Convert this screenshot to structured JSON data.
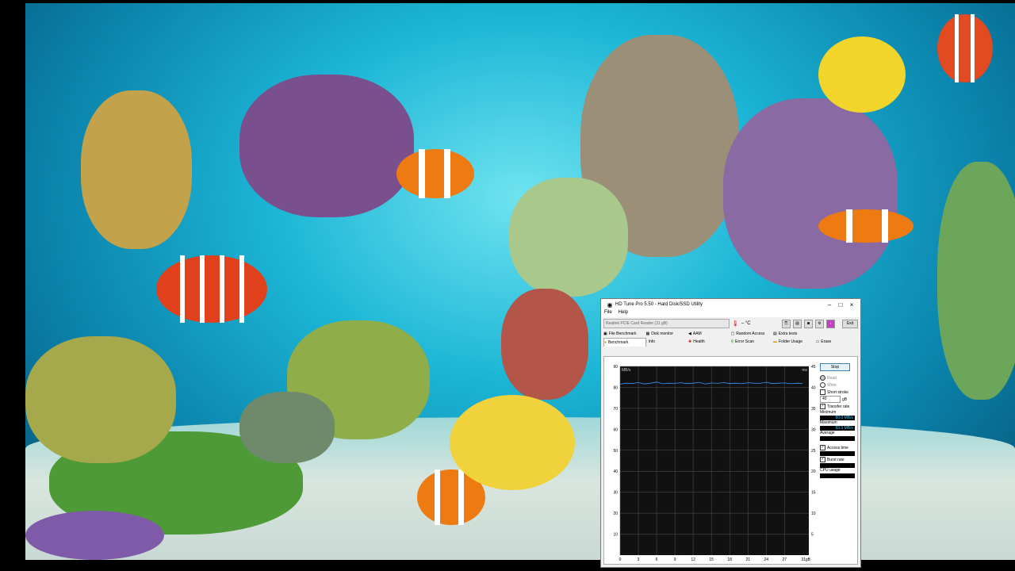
{
  "window": {
    "title": "HD Tune Pro 5.50 - Hard Disk/SSD Utility",
    "minimize": "–",
    "maximize": "□",
    "close": "×"
  },
  "menu": [
    "File",
    "Help"
  ],
  "toolbar": {
    "drive": "Realtek PCIE Card Reader (31 gB)",
    "temperature": "– °C",
    "exit": "Exit"
  },
  "tabs": {
    "row1": [
      "File Benchmark",
      "Disk monitor",
      "AAM",
      "Random Access",
      "Extra tests"
    ],
    "row2": [
      "Benchmark",
      "Info",
      "Health",
      "Error Scan",
      "Folder Usage",
      "Erase"
    ]
  },
  "side": {
    "stop_label": "Stop",
    "read_label": "Read",
    "write_label": "Write",
    "short_stroke_label": "Short stroke",
    "stroke_value": "40",
    "stroke_unit": "gB",
    "transfer_rate_label": "Transfer rate",
    "minimum_label": "Minimum",
    "minimum_value": "80.0 MB/s",
    "maximum_label": "Maximum",
    "maximum_value": "83.3 MB/s",
    "average_label": "Average",
    "average_value": "",
    "access_time_label": "Access time",
    "access_time_value": "",
    "burst_rate_label": "Burst rate",
    "burst_rate_value": "",
    "cpu_usage_label": "CPU usage",
    "cpu_usage_value": ""
  },
  "chart_data": {
    "type": "line",
    "ylabel": "MB/s",
    "y2label": "ms",
    "xunit": "31gB",
    "ylim": [
      0,
      90
    ],
    "y2lim": [
      0,
      45
    ],
    "xlim": [
      0,
      31
    ],
    "y_ticks": [
      10,
      20,
      30,
      40,
      50,
      60,
      70,
      80,
      90
    ],
    "y2_ticks": [
      5,
      10,
      15,
      20,
      25,
      30,
      35,
      40,
      45
    ],
    "x_ticks": [
      0,
      3,
      6,
      9,
      12,
      15,
      18,
      21,
      24,
      27
    ],
    "series": [
      {
        "values_x": [
          0,
          1,
          2,
          3,
          4,
          5,
          6,
          7,
          8,
          9,
          10,
          11,
          12,
          13,
          14,
          15,
          16,
          17,
          18,
          19,
          20,
          21,
          22,
          23,
          24,
          25,
          26,
          27,
          28,
          29,
          30
        ],
        "values": [
          81.5,
          82,
          81.8,
          82.3,
          81.6,
          82,
          82.5,
          81.7,
          82,
          81.9,
          82.2,
          81.8,
          82,
          82.4,
          81.6,
          82.1,
          81.9,
          82.3,
          81.8,
          82,
          81.7,
          82.2,
          82,
          81.9,
          82.4,
          81.8,
          82,
          82.1,
          81.7,
          82,
          81.9
        ],
        "color": "#3399ff"
      }
    ]
  },
  "colors": {
    "window_bg": "#f0f0f0",
    "chart_bg": "#111111",
    "grid": "#555555",
    "line": "#3399ff",
    "value_text": "#33ccff"
  }
}
